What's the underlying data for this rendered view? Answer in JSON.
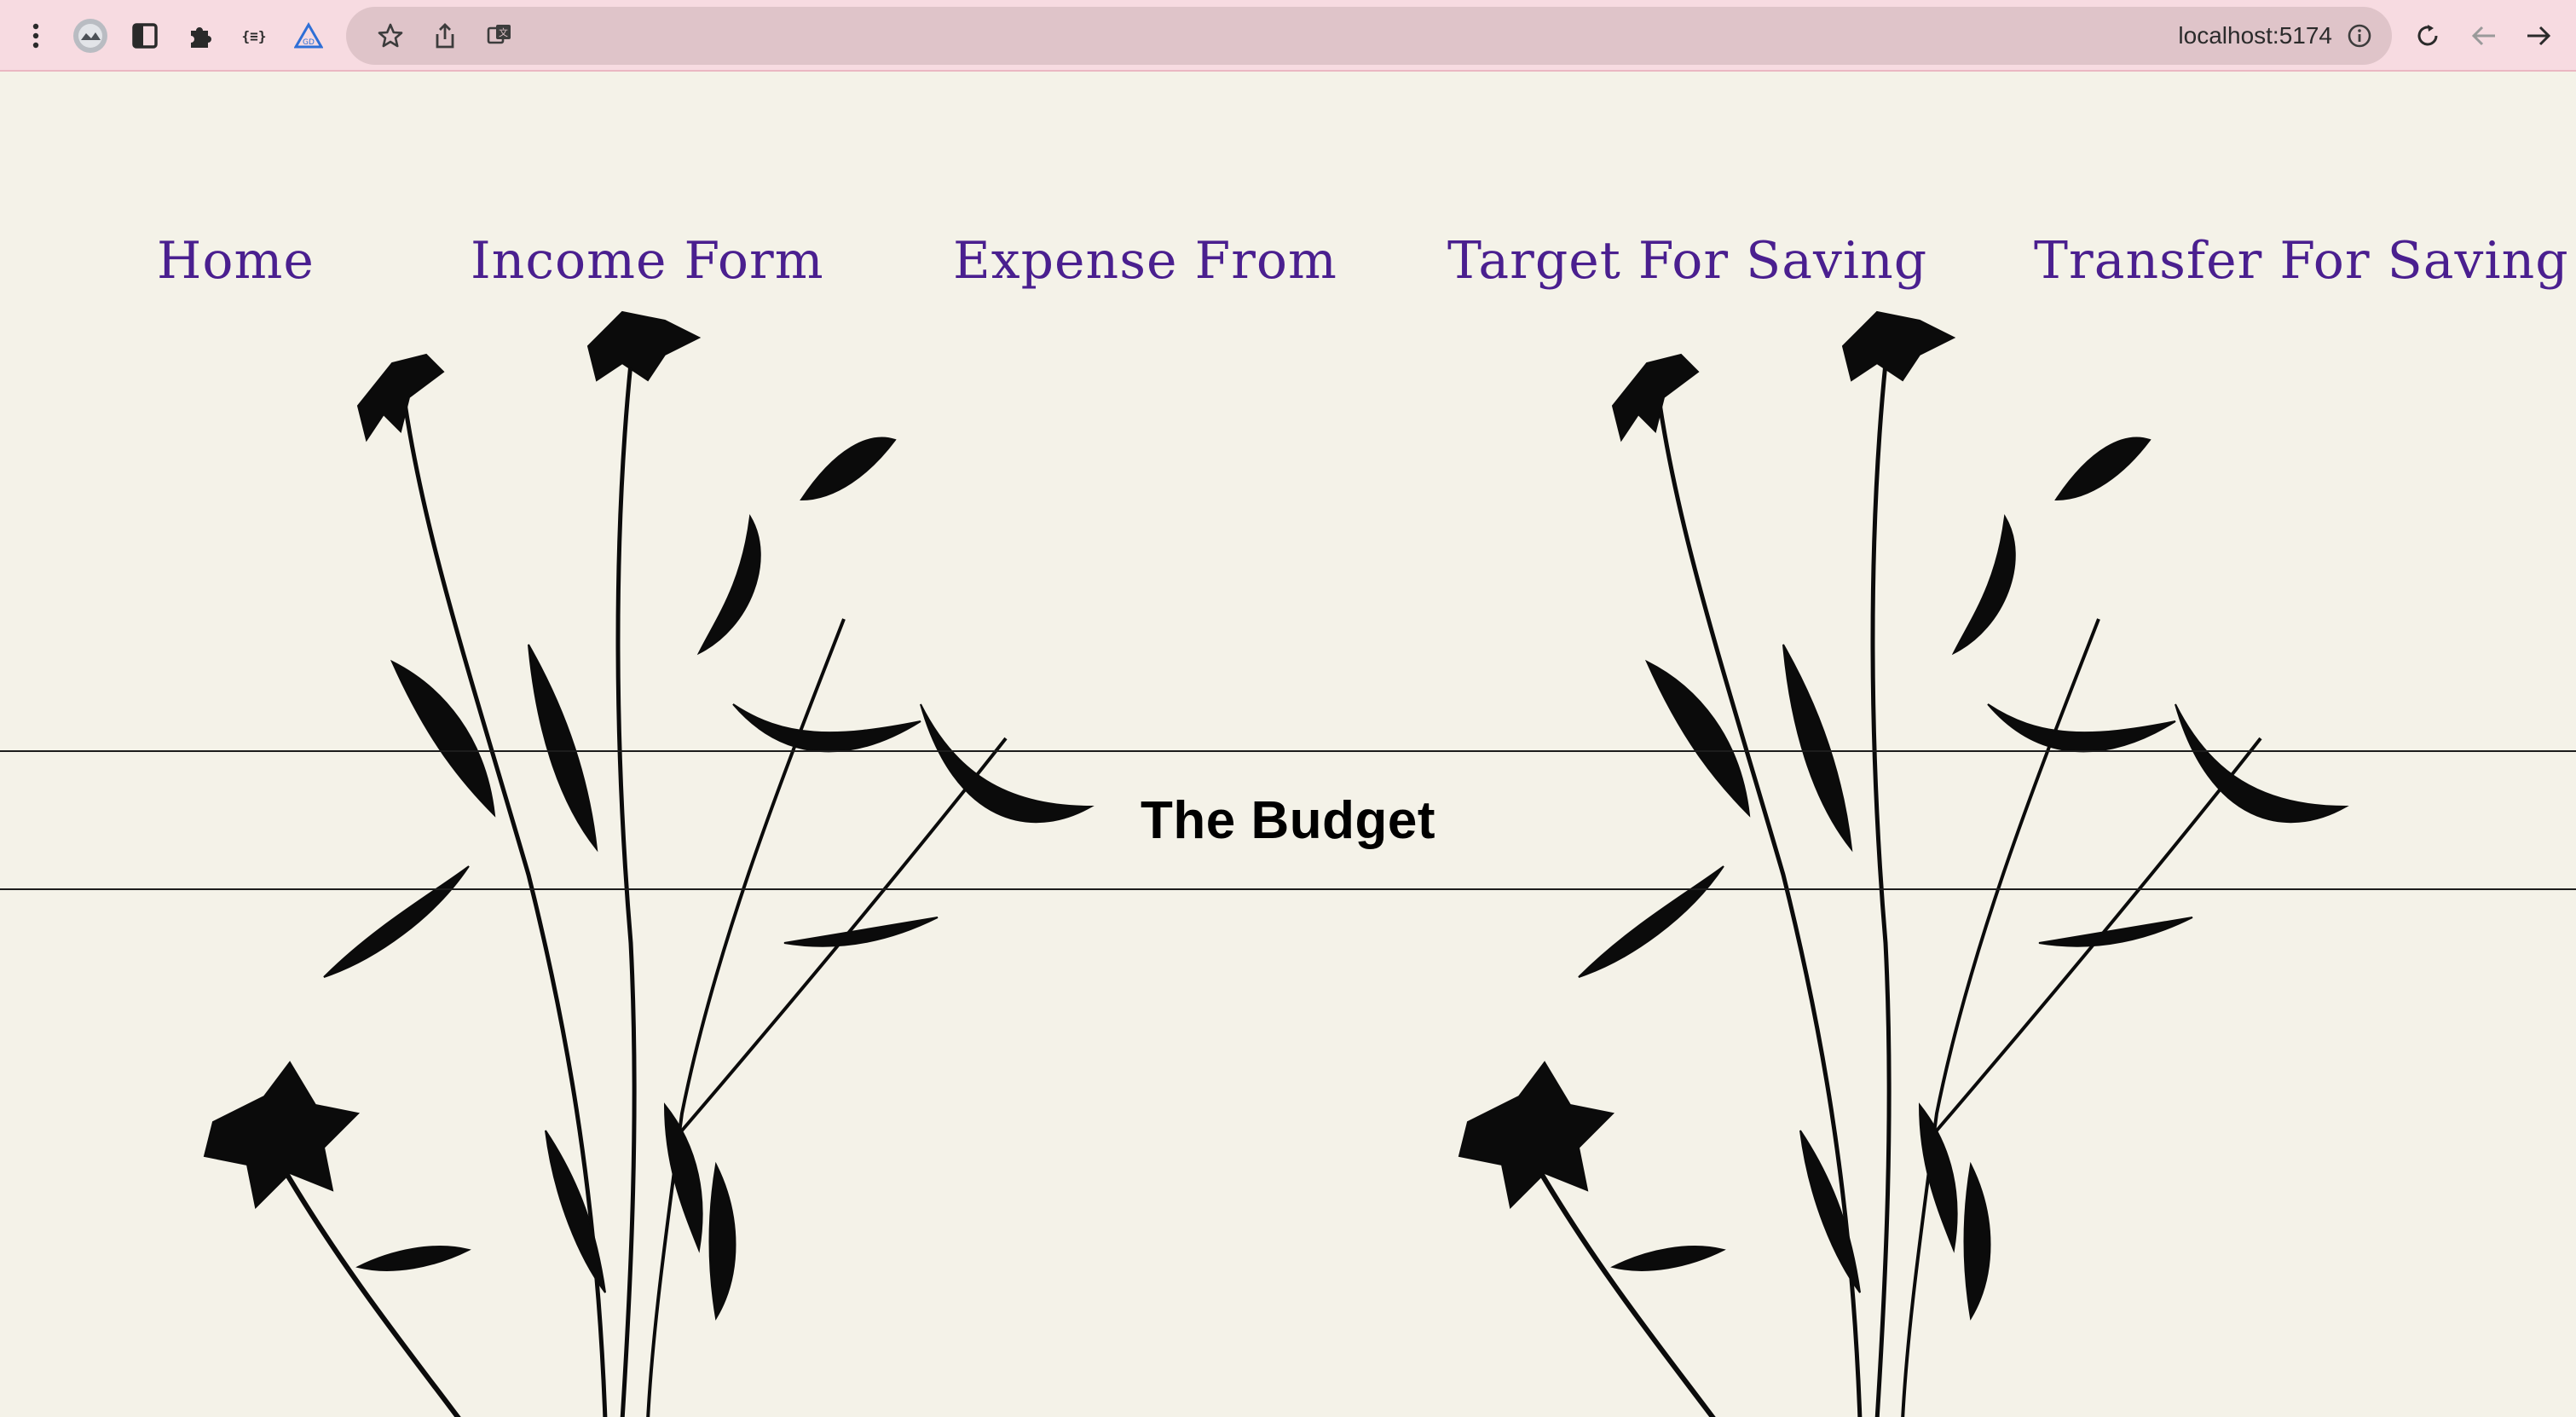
{
  "browser": {
    "url": "localhost:5174",
    "icons": [
      "menu-dots-icon",
      "profile-avatar",
      "sidebar-icon",
      "extensions-icon",
      "json-extension-icon",
      "triangle-extension-icon",
      "bookmark-star-icon",
      "share-icon",
      "translate-icon",
      "site-info-icon",
      "reload-icon",
      "back-icon",
      "forward-icon"
    ]
  },
  "nav": {
    "items": [
      {
        "label": "Home"
      },
      {
        "label": "Income Form"
      },
      {
        "label": "Expense From"
      },
      {
        "label": "Target For Saving"
      },
      {
        "label": "Transfer For Saving"
      }
    ]
  },
  "banner": {
    "title": "The Budget"
  },
  "colors": {
    "background": "#f4f2e8",
    "nav_link": "#4a1f8f",
    "toolbar": "#f7dbe1",
    "omnibox": "#dfc4c9"
  }
}
